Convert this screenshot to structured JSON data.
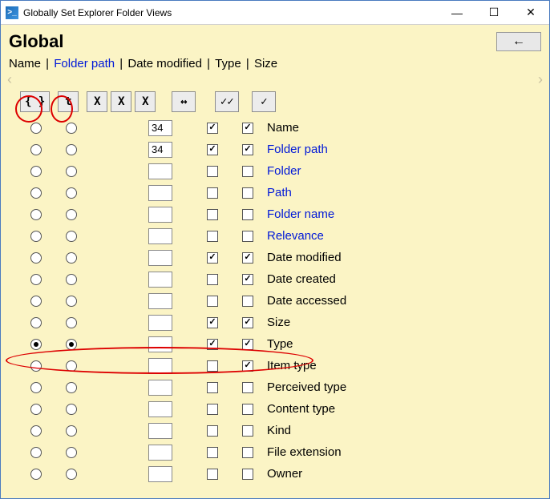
{
  "window": {
    "title": "Globally Set Explorer Folder Views",
    "app_icon_glyph": ">_",
    "min_glyph": "—",
    "max_glyph": "☐",
    "close_glyph": "✕"
  },
  "header": {
    "title": "Global",
    "back_glyph": "←"
  },
  "breadcrumb": {
    "items": [
      {
        "label": "Name",
        "link": false
      },
      {
        "label": "Folder path",
        "link": true
      },
      {
        "label": "Date modified",
        "link": false
      },
      {
        "label": "Type",
        "link": false
      },
      {
        "label": "Size",
        "link": false
      }
    ],
    "sep": " | "
  },
  "scroll_hint": {
    "left": "‹",
    "right": "›"
  },
  "col_buttons": {
    "braces": "{ }",
    "t": "t",
    "x1": "X",
    "x2": "X",
    "x3": "X",
    "arrows": "↔",
    "dblcheck": "✓✓",
    "check": "✓"
  },
  "rows": [
    {
      "r1": false,
      "r2": false,
      "num": "34",
      "c1": true,
      "c2": true,
      "label": "Name",
      "link": false
    },
    {
      "r1": false,
      "r2": false,
      "num": "34",
      "c1": true,
      "c2": true,
      "label": "Folder path",
      "link": true
    },
    {
      "r1": false,
      "r2": false,
      "num": "",
      "c1": false,
      "c2": false,
      "label": "Folder",
      "link": true
    },
    {
      "r1": false,
      "r2": false,
      "num": "",
      "c1": false,
      "c2": false,
      "label": "Path",
      "link": true
    },
    {
      "r1": false,
      "r2": false,
      "num": "",
      "c1": false,
      "c2": false,
      "label": "Folder name",
      "link": true
    },
    {
      "r1": false,
      "r2": false,
      "num": "",
      "c1": false,
      "c2": false,
      "label": "Relevance",
      "link": true
    },
    {
      "r1": false,
      "r2": false,
      "num": "",
      "c1": true,
      "c2": true,
      "label": "Date modified",
      "link": false
    },
    {
      "r1": false,
      "r2": false,
      "num": "",
      "c1": false,
      "c2": true,
      "label": "Date created",
      "link": false
    },
    {
      "r1": false,
      "r2": false,
      "num": "",
      "c1": false,
      "c2": false,
      "label": "Date accessed",
      "link": false
    },
    {
      "r1": false,
      "r2": false,
      "num": "",
      "c1": true,
      "c2": true,
      "label": "Size",
      "link": false
    },
    {
      "r1": true,
      "r2": true,
      "num": "",
      "c1": true,
      "c2": true,
      "label": "Type",
      "link": false
    },
    {
      "r1": false,
      "r2": false,
      "num": "",
      "c1": false,
      "c2": true,
      "label": "Item type",
      "link": false
    },
    {
      "r1": false,
      "r2": false,
      "num": "",
      "c1": false,
      "c2": false,
      "label": "Perceived type",
      "link": false
    },
    {
      "r1": false,
      "r2": false,
      "num": "",
      "c1": false,
      "c2": false,
      "label": "Content type",
      "link": false
    },
    {
      "r1": false,
      "r2": false,
      "num": "",
      "c1": false,
      "c2": false,
      "label": "Kind",
      "link": false
    },
    {
      "r1": false,
      "r2": false,
      "num": "",
      "c1": false,
      "c2": false,
      "label": "File extension",
      "link": false
    },
    {
      "r1": false,
      "r2": false,
      "num": "",
      "c1": false,
      "c2": false,
      "label": "Owner",
      "link": false
    }
  ]
}
